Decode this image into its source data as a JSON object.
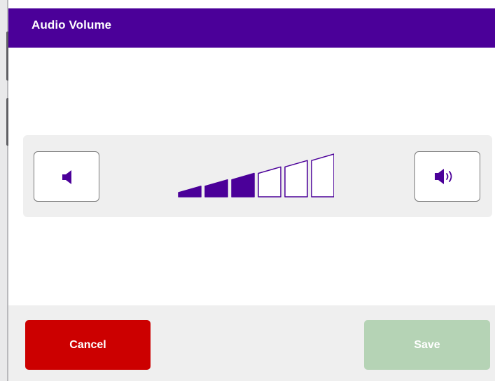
{
  "dialog": {
    "title": "Audio Volume"
  },
  "volume": {
    "decrease_icon": "speaker-low-icon",
    "increase_icon": "speaker-high-icon",
    "level": 3,
    "max_level": 6,
    "active_color": "#4b0099"
  },
  "footer": {
    "cancel_label": "Cancel",
    "save_label": "Save",
    "cancel_color": "#cc0000",
    "save_color": "#b5d3b5"
  }
}
